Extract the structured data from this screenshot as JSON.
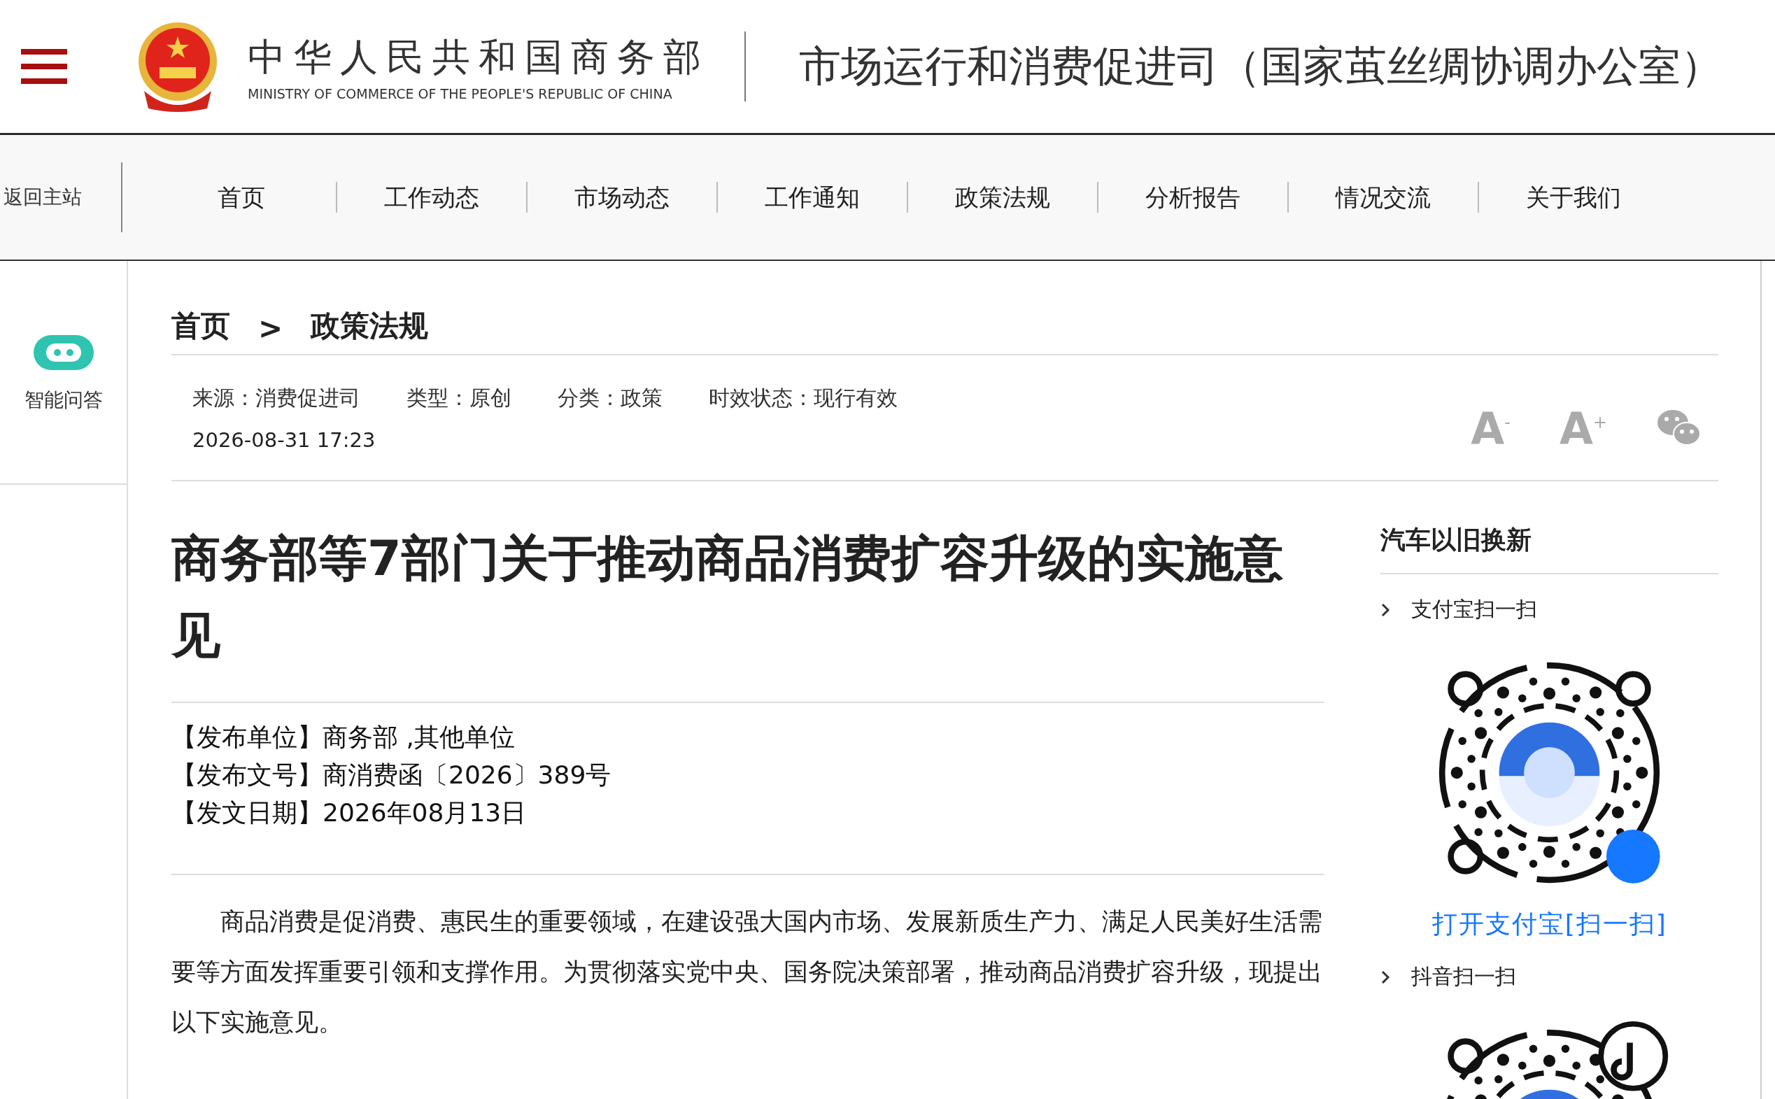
{
  "header": {
    "ministry_name": "中华人民共和国商务部",
    "ministry_name_en": "MINISTRY OF COMMERCE OF THE PEOPLE'S REPUBLIC OF CHINA",
    "department": "市场运行和消费促进司（国家茧丝绸协调办公室）"
  },
  "nav": {
    "back_link": "返回主站",
    "items": [
      "首页",
      "工作动态",
      "市场动态",
      "工作通知",
      "政策法规",
      "分析报告",
      "情况交流",
      "关于我们"
    ]
  },
  "sidebar": {
    "assistant_label": "智能问答"
  },
  "breadcrumb": {
    "items": [
      "首页",
      "政策法规"
    ],
    "separator": ">"
  },
  "meta": {
    "fields": [
      "来源：消费促进司",
      "类型：原创",
      "分类：政策",
      "时效状态：现行有效"
    ],
    "date": "2026-08-31 17:23",
    "tools": [
      {
        "kind": "smaller",
        "label": "A$^{-}$"
      },
      {
        "kind": "larger",
        "label": "A$^{+}$"
      },
      {
        "kind": "wechat"
      }
    ]
  },
  "article": {
    "title": "商务部等7部门关于推动商品消费扩容升级的实施意见",
    "info": [
      {
        "label": "【发布单位】",
        "value": "商务部 ,其他单位"
      },
      {
        "label": "【发布文号】",
        "value": "商消费函〔2026〕389号"
      },
      {
        "label": "【发文日期】",
        "value": "2026年08月13日"
      }
    ],
    "body": "商品消费是促消费、惠民生的重要领域，在建设强大国内市场、发展新质生产力、满足人民美好生活需要等方面发挥重要引领和支撑作用。为贯彻落实党中央、国务院决策部署，推动商品消费扩容升级，现提出以下实施意见。"
  },
  "side_panel": {
    "heading": "汽车以旧换新",
    "sections": [
      {
        "kind": "alipay",
        "label": "支付宝扫一扫",
        "caption": "打开支付宝[扫一扫]"
      },
      {
        "kind": "douyin",
        "label": "抖音扫一扫"
      }
    ]
  }
}
